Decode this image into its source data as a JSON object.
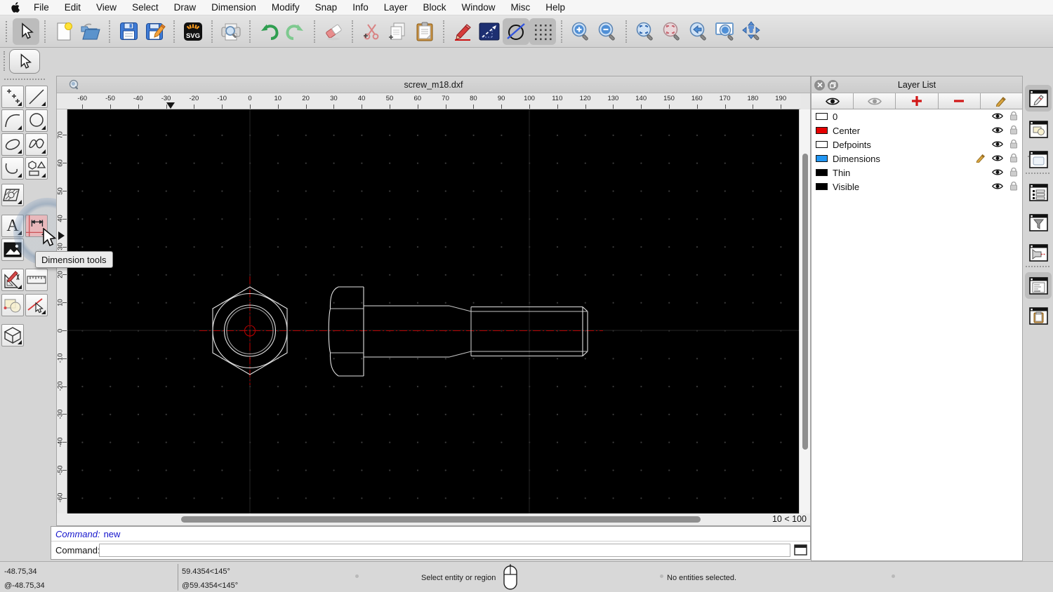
{
  "menu_bar": {
    "apple_icon": "apple-logo",
    "items": [
      "File",
      "Edit",
      "View",
      "Select",
      "Draw",
      "Dimension",
      "Modify",
      "Snap",
      "Info",
      "Layer",
      "Block",
      "Window",
      "Misc",
      "Help"
    ]
  },
  "toolbar": {
    "svg_icon_label": "SVG",
    "buttons": [
      "select",
      "new-document",
      "open",
      "save",
      "save-as",
      "svg-export",
      "print-preview",
      "undo",
      "redo",
      "eraser",
      "cut",
      "copy",
      "paste",
      "pen",
      "line-attributes",
      "pen-color",
      "grid-toggle",
      "zoom-in",
      "zoom-out",
      "zoom-auto",
      "zoom-selected",
      "zoom-previous",
      "zoom-window",
      "zoom-pan"
    ]
  },
  "palette": {
    "tools": [
      "points",
      "line",
      "arc",
      "circle",
      "ellipse",
      "spline",
      "polyline",
      "shapes",
      "hatch",
      "text",
      "dimension",
      "image",
      "modify",
      "measure",
      "blocks",
      "select-entity",
      "solid"
    ],
    "text_tool_glyph": "A",
    "tooltip": "Dimension tools"
  },
  "document": {
    "title": "screw_m18.dxf",
    "grid_status": "10 < 100"
  },
  "rulers": {
    "h_values": [
      -60,
      -50,
      -40,
      -30,
      -20,
      -10,
      0,
      10,
      20,
      30,
      40,
      50,
      60,
      70,
      80,
      90,
      100,
      110,
      120,
      130,
      140,
      150,
      160,
      170,
      180,
      190
    ],
    "v_values": [
      70,
      60,
      50,
      40,
      30,
      20,
      10,
      0,
      -10,
      -20,
      -30,
      -40,
      -50,
      -60
    ]
  },
  "layer_panel": {
    "title": "Layer List",
    "layers": [
      {
        "name": "0",
        "color": "#ffffff",
        "active": false
      },
      {
        "name": "Center",
        "color": "#e60000",
        "active": false
      },
      {
        "name": "Defpoints",
        "color": "#ffffff",
        "active": false
      },
      {
        "name": "Dimensions",
        "color": "#2196f3",
        "active": true
      },
      {
        "name": "Thin",
        "color": "#000000",
        "active": false
      },
      {
        "name": "Visible",
        "color": "#000000",
        "active": false
      }
    ]
  },
  "command": {
    "history_prefix": "Command:",
    "history_value": "new",
    "prompt_label": "Command:",
    "input_value": ""
  },
  "status_bar": {
    "abs_coord": "-48.75,34",
    "rel_coord": "@-48.75,34",
    "abs_polar": "59.4354<145°",
    "rel_polar": "@59.4354<145°",
    "hint": "Select entity or region",
    "selection_info": "No entities selected."
  },
  "colors": {
    "accent_red": "#cc1111",
    "layer_blue": "#2196f3",
    "centerline_red": "#b30000",
    "canvas_bg": "#000000"
  }
}
